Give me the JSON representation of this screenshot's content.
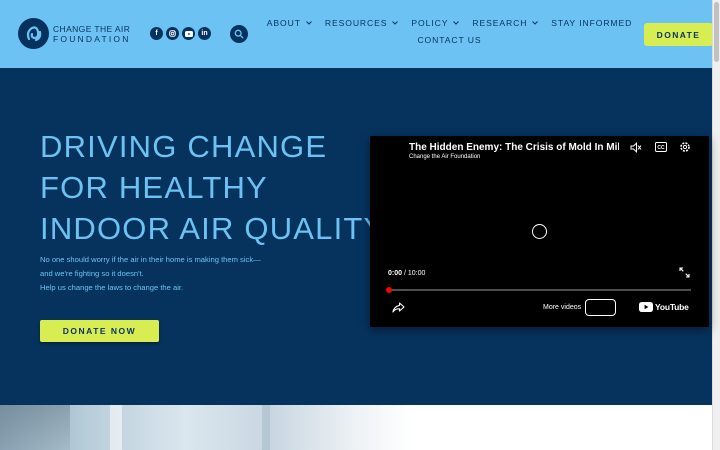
{
  "header": {
    "logo": {
      "line1": "CHANGE THE AIR",
      "line2": "FOUNDATION"
    },
    "socials": [
      {
        "icon": "facebook-icon",
        "glyph": "f"
      },
      {
        "icon": "instagram-icon",
        "glyph": ""
      },
      {
        "icon": "youtube-icon",
        "glyph": ""
      },
      {
        "icon": "linkedin-icon",
        "glyph": "in"
      }
    ],
    "nav_row1": [
      {
        "label": "ABOUT",
        "has_dropdown": true
      },
      {
        "label": "RESOURCES",
        "has_dropdown": true
      },
      {
        "label": "POLICY",
        "has_dropdown": true
      },
      {
        "label": "RESEARCH",
        "has_dropdown": true
      },
      {
        "label": "STAY INFORMED",
        "has_dropdown": false
      }
    ],
    "nav_row2": [
      {
        "label": "CONTACT US",
        "has_dropdown": false
      }
    ],
    "donate_label": "DONATE"
  },
  "hero": {
    "headline": [
      "DRIVING CHANGE",
      "FOR HEALTHY",
      "INDOOR AIR QUALITY"
    ],
    "subtext": [
      "No one should worry if the air in their home is making them sick—",
      "and we're fighting so it doesn't.",
      "Help us change the laws to change the air."
    ],
    "donate_label": "DONATE NOW"
  },
  "video": {
    "title": "The Hidden Enemy: The Crisis of Mold In Military Housing",
    "channel": "Change the Air Foundation",
    "time_current": "0:00",
    "time_separator": " / ",
    "time_total": "10:00",
    "progress_fraction": 0.0,
    "more_videos_label": "More videos",
    "youtube_label": "YouTube"
  },
  "colors": {
    "header_bg": "#6cc3f3",
    "hero_bg": "#06335e",
    "accent": "#d8ed52",
    "brand_dark": "#06335e",
    "video_progress": "#ff0000"
  }
}
